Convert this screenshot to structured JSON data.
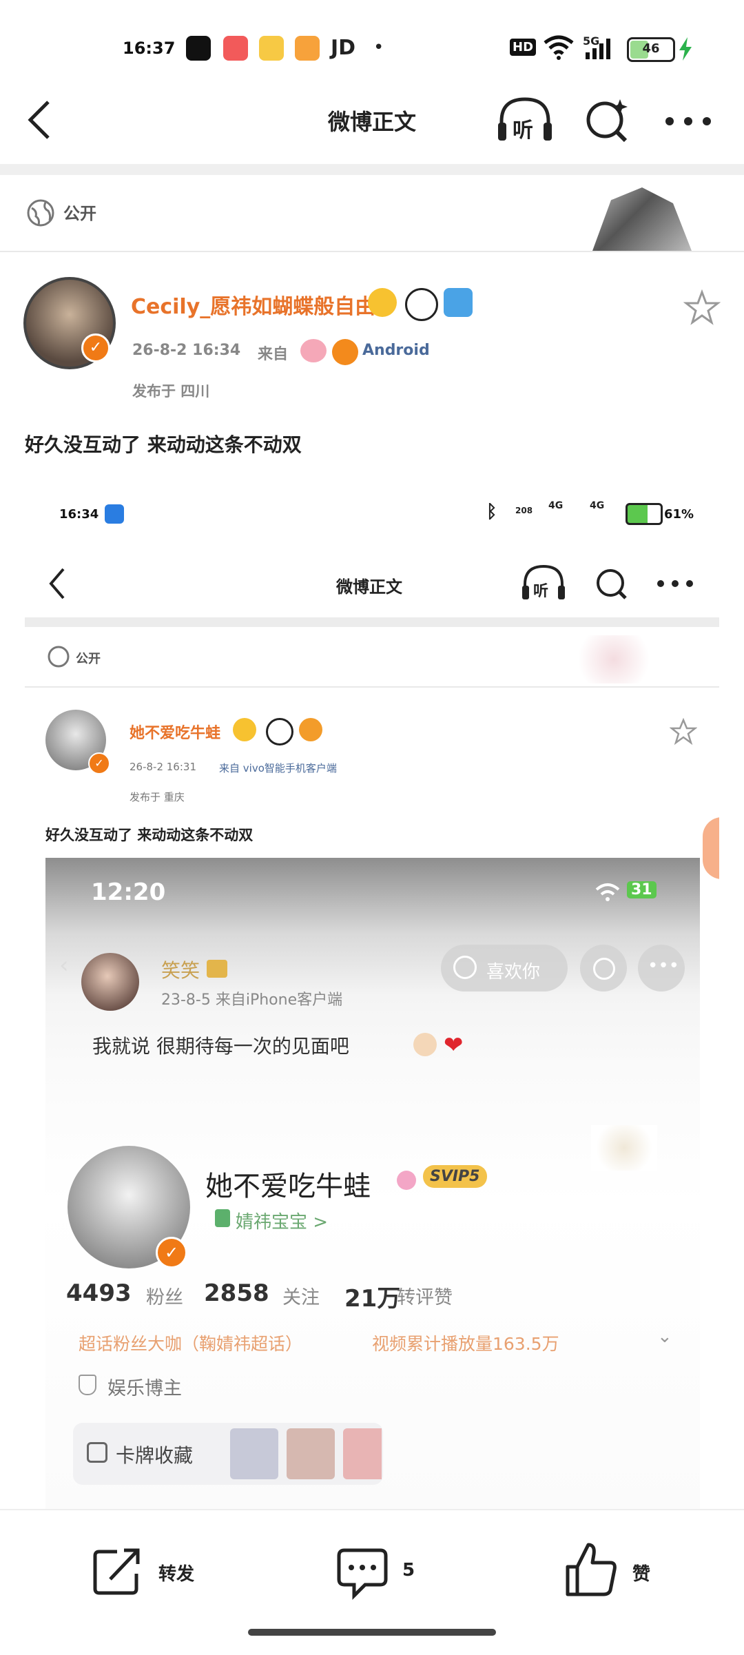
{
  "status_bar": {
    "time": "16:37",
    "jd": "JD",
    "dot": "•",
    "hd": "HD",
    "network": "5G",
    "battery": "46"
  },
  "header": {
    "title": "微博正文",
    "listen_label": "听"
  },
  "post": {
    "visibility": "公开",
    "username": "Cecily_愿祎如蝴蝶般自由",
    "date": "26-8-2  16:34",
    "source_prefix": "来自",
    "source": "Android",
    "location": "发布于  四川",
    "text": "好久没互动了  来动动这条不动双"
  },
  "inner": {
    "status_time": "16:34",
    "status_right": "61%",
    "net_a": "4G",
    "net_b": "4G",
    "speed": "208",
    "header_title": "微博正文",
    "listen_label": "听",
    "visibility": "公开",
    "username": "她不爱吃牛蛙",
    "date": "26-8-2 16:31",
    "source": "来自 vivo智能手机客户端",
    "location": "发布于 重庆",
    "text": "好久没互动了 来动动这条不动双",
    "shot": {
      "time": "12:20",
      "battery": "31",
      "like_button": "喜欢你",
      "comment_name": "笑笑",
      "comment_meta": "23-8-5  来自iPhone客户端",
      "comment_text": "我就说 很期待每一次的见面吧",
      "profile_name": "她不爱吃牛蛙",
      "vip": "SVIP5",
      "group": "婧祎宝宝 >",
      "fans_n": "4493",
      "fans_l": "粉丝",
      "follow_n": "2858",
      "follow_l": "关注",
      "likes_n": "21万",
      "likes_l": "转评赞",
      "fan_title": "超话粉丝大咖（鞠婧祎超话）",
      "video_stat": "视频累计播放量163.5万",
      "tag": "娱乐博主",
      "cards": "卡牌收藏"
    }
  },
  "bottom_bar": {
    "repost": "转发",
    "comment_count": "5",
    "like": "赞"
  }
}
